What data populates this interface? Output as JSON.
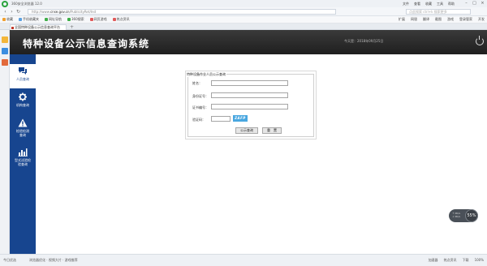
{
  "browser": {
    "app_title": "360安全浏览器 12.0",
    "menus": [
      "文件",
      "查看",
      "收藏",
      "工具",
      "帮助"
    ],
    "url_prefix": "http://www.",
    "url_domain": "cnse.gov.cn",
    "url_path": "/PublicityRet/Ind",
    "search_placeholder": "点此搜索 ctrl+k 搜索更多",
    "bookmarks": [
      "收藏",
      "手机收藏夹",
      "网址导航",
      "360搜索",
      "网页游戏",
      "热点资讯"
    ],
    "bookmarks_right": [
      "扩展",
      "网银",
      "翻译",
      "截图",
      "游戏",
      "登录管家",
      "开发"
    ],
    "tab_title": "全国特种设备公示信息查询平台"
  },
  "header": {
    "site_title": "特种设备公示信息查询系统",
    "date_text": "今天是：2018年09月25日"
  },
  "sidebar": {
    "items": [
      {
        "label": "人员查询",
        "icon": "chat-bubbles-icon"
      },
      {
        "label": "机构查询",
        "icon": "gear-icon"
      },
      {
        "label": "检验检测\n查询",
        "icon": "warning-triangle-icon"
      },
      {
        "label": "型式试验检\n验查询",
        "icon": "bar-chart-icon"
      }
    ]
  },
  "form": {
    "legend": "特种设备作业人员公示查询",
    "name_label": "姓名：",
    "idcard_label": "身份证号：",
    "cert_label": "证书编号：",
    "captcha_label": "验证码：",
    "captcha_text": "ZAFP",
    "submit_label": "公示查询",
    "reset_label": "重　置"
  },
  "speed_widget": {
    "percent": "55%",
    "up": "↑ 0K/s",
    "down": "↓ 0K/s"
  },
  "statusbar": {
    "left": "今日优选",
    "middle": "浏览器优化 · 视频大片 · 游戏推荐",
    "right": [
      "加速器",
      "热点资讯",
      "下载",
      "100%"
    ]
  },
  "colors": {
    "sidebar_bg": "#17458f",
    "header_bg": "#2b2b2b",
    "captcha_bg": "#49a7e0"
  }
}
